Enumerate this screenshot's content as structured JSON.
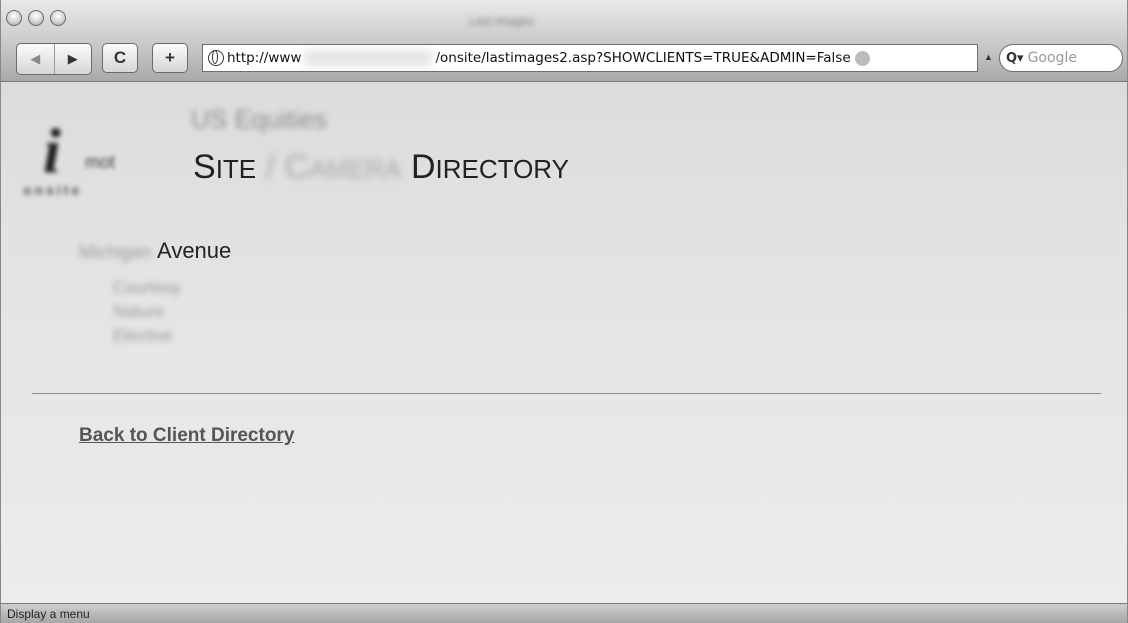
{
  "window": {
    "title": "Last Images"
  },
  "toolbar": {
    "back_icon": "back-arrow-icon",
    "back_glyph": "◀",
    "forward_icon": "forward-arrow-icon",
    "forward_glyph": "▶",
    "reload_glyph": "C",
    "add_glyph": "+",
    "url_prefix": "http://www",
    "url_suffix": "/onsite/lastimages2.asp?SHOWCLIENTS=TRUE&ADMIN=False",
    "search_icon_glyph": "Q▾",
    "search_placeholder": "Google"
  },
  "page": {
    "logo_letter": "i",
    "logo_small": "mot",
    "logo_subtext": "onsite",
    "client_name": "US Equities",
    "heading": {
      "site": "Site",
      "separator": "/",
      "camera": "Camera",
      "directory": "Directory"
    },
    "site_name_blurred": "Michigan",
    "site_name": "Avenue",
    "cameras": [
      "Courtesy",
      "Nature",
      "Elective"
    ],
    "back_link": "Back to Client Directory"
  },
  "status": {
    "text": "Display a menu"
  }
}
